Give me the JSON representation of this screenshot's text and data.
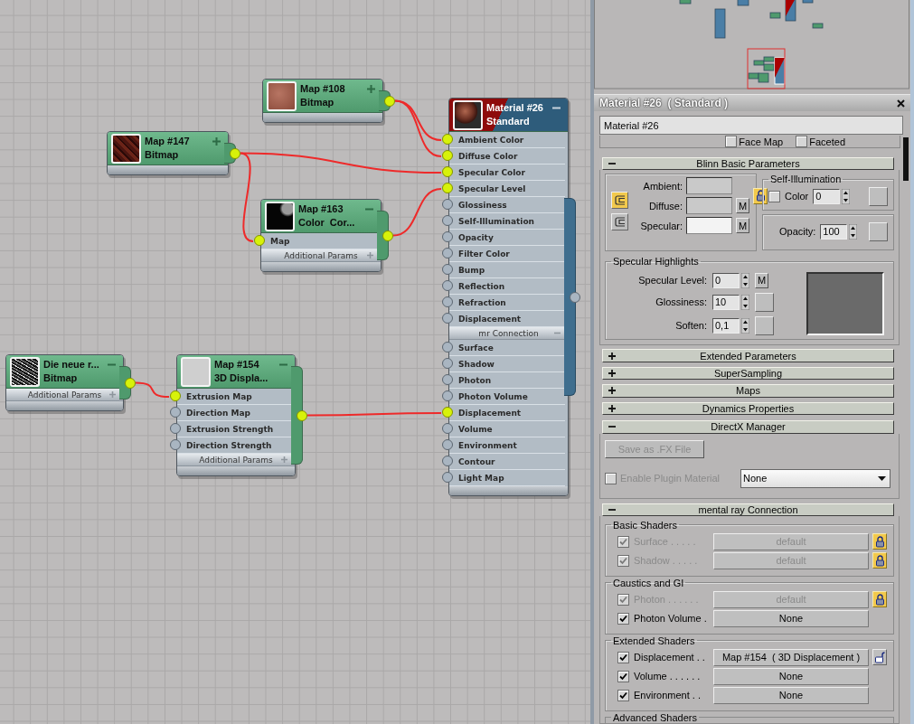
{
  "nodes": [
    {
      "kind": "map",
      "title": "Map #108",
      "subtitle": "Bitmap",
      "thumbnail": {
        "kind": "brick"
      },
      "expanded": false,
      "output_connected": true
    },
    {
      "kind": "map",
      "title": "Map #147",
      "subtitle": "Bitmap",
      "thumbnail": {
        "kind": "dark-red"
      },
      "expanded": false,
      "output_connected": true
    },
    {
      "kind": "map",
      "title": "Map #163",
      "subtitle": "Color  Cor...",
      "thumbnail": {
        "kind": "black"
      },
      "expanded": true,
      "output_connected": true,
      "rows": [
        {
          "kind": "slot",
          "label": "Map",
          "connected": true
        },
        {
          "kind": "section",
          "label": "Additional Params",
          "expanded": false
        }
      ]
    },
    {
      "kind": "material",
      "title": "Material #26",
      "subtitle": "Standard",
      "thumbnail": {
        "kind": "sphere"
      },
      "expanded": true,
      "output_connected": false,
      "rows": [
        {
          "kind": "slot",
          "label": "Ambient Color",
          "connected": true
        },
        {
          "kind": "slot",
          "label": "Diffuse Color",
          "connected": true
        },
        {
          "kind": "slot",
          "label": "Specular Color",
          "connected": true
        },
        {
          "kind": "slot",
          "label": "Specular Level",
          "connected": true
        },
        {
          "kind": "slot",
          "label": "Glossiness",
          "connected": false
        },
        {
          "kind": "slot",
          "label": "Self-Illumination",
          "connected": false
        },
        {
          "kind": "slot",
          "label": "Opacity",
          "connected": false
        },
        {
          "kind": "slot",
          "label": "Filter Color",
          "connected": false
        },
        {
          "kind": "slot",
          "label": "Bump",
          "connected": false
        },
        {
          "kind": "slot",
          "label": "Reflection",
          "connected": false
        },
        {
          "kind": "slot",
          "label": "Refraction",
          "connected": false
        },
        {
          "kind": "slot",
          "label": "Displacement",
          "connected": false
        },
        {
          "kind": "section",
          "label": "mr Connection",
          "expanded": true
        },
        {
          "kind": "slot",
          "label": "Surface",
          "connected": false
        },
        {
          "kind": "slot",
          "label": "Shadow",
          "connected": false
        },
        {
          "kind": "slot",
          "label": "Photon",
          "connected": false
        },
        {
          "kind": "slot",
          "label": "Photon Volume",
          "connected": false
        },
        {
          "kind": "slot",
          "label": "Displacement",
          "connected": true
        },
        {
          "kind": "slot",
          "label": "Volume",
          "connected": false
        },
        {
          "kind": "slot",
          "label": "Environment",
          "connected": false
        },
        {
          "kind": "slot",
          "label": "Contour",
          "connected": false
        },
        {
          "kind": "slot",
          "label": "Light Map",
          "connected": false
        }
      ]
    },
    {
      "kind": "map",
      "title": "Die neue r...",
      "subtitle": "Bitmap",
      "thumbnail": {
        "kind": "noise"
      },
      "expanded": true,
      "output_connected": true,
      "rows": [
        {
          "kind": "section",
          "label": "Additional Params",
          "expanded": false
        }
      ]
    },
    {
      "kind": "map",
      "title": "Map #154",
      "subtitle": "3D Displa...",
      "thumbnail": {
        "kind": "blank"
      },
      "expanded": true,
      "output_connected": true,
      "rows": [
        {
          "kind": "slot",
          "label": "Extrusion Map",
          "connected": true
        },
        {
          "kind": "slot",
          "label": "Direction Map",
          "connected": false
        },
        {
          "kind": "slot",
          "label": "Extrusion Strength",
          "connected": false
        },
        {
          "kind": "slot",
          "label": "Direction Strength",
          "connected": false
        },
        {
          "kind": "section",
          "label": "Additional Params",
          "expanded": false
        }
      ]
    }
  ],
  "material_panel": {
    "title": "Material #26  ( Standard )",
    "name": "Material #26",
    "partial_options": [
      {
        "label": "Face Map",
        "checked": false
      },
      {
        "label": "Faceted",
        "checked": false
      }
    ],
    "rollouts": [
      {
        "kind": "blinn",
        "title": "Blinn Basic Parameters",
        "expanded": true,
        "toggles": [
          {
            "selected": true
          },
          {
            "selected": false
          }
        ],
        "swatches": [
          {
            "label": "Ambient:",
            "color": "#c9c9c9"
          },
          {
            "label": "Diffuse:",
            "color": "#c9c9c9",
            "map": "M"
          },
          {
            "label": "Specular:",
            "color": "#f3f3f3",
            "map": "M"
          }
        ],
        "color_locked": true,
        "self_illumination": {
          "title": "Self-Illumination",
          "label": "Color",
          "checked": false,
          "value": "0"
        },
        "opacity": {
          "label": "Opacity:",
          "value": "100"
        },
        "specular_highlights": {
          "title": "Specular Highlights",
          "params": [
            {
              "label": "Specular Level:",
              "value": "0",
              "map": "M"
            },
            {
              "label": "Glossiness:",
              "value": "10"
            },
            {
              "label": "Soften:",
              "value": "0,1"
            }
          ]
        }
      },
      {
        "kind": "plain",
        "title": "Extended Parameters",
        "expanded": false
      },
      {
        "kind": "plain",
        "title": "SuperSampling",
        "expanded": false
      },
      {
        "kind": "plain",
        "title": "Maps",
        "expanded": false
      },
      {
        "kind": "plain",
        "title": "Dynamics Properties",
        "expanded": false
      },
      {
        "kind": "directx",
        "title": "DirectX Manager",
        "expanded": true,
        "button": {
          "label": "Save as .FX File",
          "disabled": true
        },
        "plugin": {
          "label": "Enable Plugin Material",
          "checked": false,
          "disabled": true
        },
        "dropdown": "None"
      },
      {
        "kind": "mentalray",
        "title": "mental ray Connection",
        "expanded": true,
        "groups": [
          {
            "title": "Basic Shaders",
            "rows": [
              {
                "label": "Surface . . . . .",
                "checked": true,
                "disabled": true,
                "value": "default",
                "lock": {
                  "locked": true
                }
              },
              {
                "label": "Shadow . . . . .",
                "checked": true,
                "disabled": true,
                "value": "default",
                "lock": {
                  "locked": true
                }
              }
            ]
          },
          {
            "title": "Caustics and GI",
            "rows": [
              {
                "label": "Photon . . . . . .",
                "checked": true,
                "disabled": true,
                "value": "default",
                "lock": {
                  "locked": true
                }
              },
              {
                "label": "Photon Volume .",
                "checked": true,
                "disabled": false,
                "value": "None"
              }
            ]
          },
          {
            "title": "Extended Shaders",
            "rows": [
              {
                "label": "Displacement . .",
                "checked": true,
                "disabled": false,
                "value": "Map #154  ( 3D Displacement )",
                "lock": {
                  "locked": false
                }
              },
              {
                "label": "Volume . . . . . .",
                "checked": true,
                "disabled": false,
                "value": "None"
              },
              {
                "label": "Environment . .",
                "checked": true,
                "disabled": false,
                "value": "None"
              }
            ]
          },
          {
            "title": "Advanced Shaders"
          }
        ]
      }
    ]
  }
}
